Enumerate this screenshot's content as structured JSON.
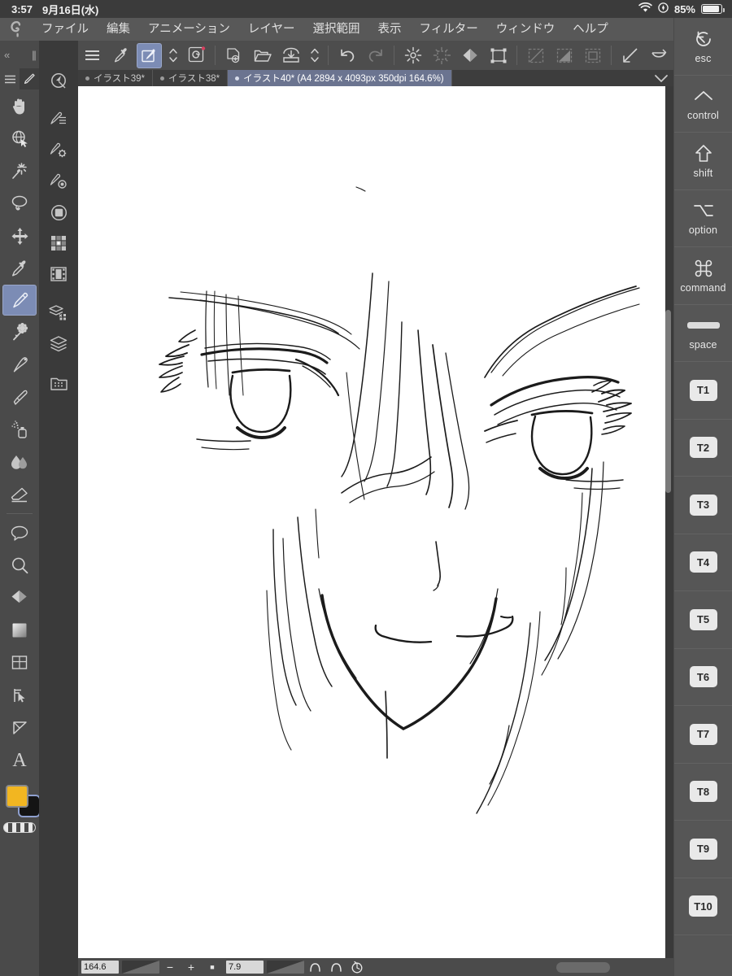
{
  "status_bar": {
    "time": "3:57",
    "date": "9月16日(水)",
    "battery_percent": "85%",
    "wifi_icon": "wifi-icon",
    "location_icon": "location-icon",
    "battery_icon": "battery-icon"
  },
  "menu_bar": {
    "app_logo": "clip-studio-logo",
    "items": [
      {
        "label": "ファイル",
        "name": "menu-file"
      },
      {
        "label": "編集",
        "name": "menu-edit"
      },
      {
        "label": "アニメーション",
        "name": "menu-animation"
      },
      {
        "label": "レイヤー",
        "name": "menu-layer"
      },
      {
        "label": "選択範囲",
        "name": "menu-selection"
      },
      {
        "label": "表示",
        "name": "menu-view"
      },
      {
        "label": "フィルター",
        "name": "menu-filter"
      },
      {
        "label": "ウィンドウ",
        "name": "menu-window"
      },
      {
        "label": "ヘルプ",
        "name": "menu-help"
      }
    ]
  },
  "command_bar": {
    "buttons": [
      {
        "name": "hamburger-menu-icon",
        "selected": false,
        "dim": false
      },
      {
        "name": "eyedropper-icon",
        "selected": false,
        "dim": false
      },
      {
        "name": "brush-swap-icon",
        "selected": true,
        "dim": false
      },
      {
        "name": "chevron-updown-icon",
        "selected": false,
        "dim": false
      },
      {
        "name": "spiral-tool-icon",
        "selected": false,
        "dim": false
      },
      {
        "name": "new-document-icon",
        "selected": false,
        "dim": false
      },
      {
        "name": "open-folder-icon",
        "selected": false,
        "dim": false
      },
      {
        "name": "save-icon",
        "selected": false,
        "dim": false
      },
      {
        "name": "chevron-updown-2-icon",
        "selected": false,
        "dim": false
      },
      {
        "name": "undo-icon",
        "selected": false,
        "dim": false
      },
      {
        "name": "redo-icon",
        "selected": false,
        "dim": true
      },
      {
        "name": "deselect-burst-icon",
        "selected": false,
        "dim": false
      },
      {
        "name": "select-burst-icon",
        "selected": false,
        "dim": true
      },
      {
        "name": "fill-diamond-icon",
        "selected": false,
        "dim": false
      },
      {
        "name": "transform-icon",
        "selected": false,
        "dim": false
      },
      {
        "name": "clear-selection-icon",
        "selected": false,
        "dim": true
      },
      {
        "name": "invert-selection-icon",
        "selected": false,
        "dim": true
      },
      {
        "name": "selection-border-icon",
        "selected": false,
        "dim": true
      },
      {
        "name": "ruler-snap-icon",
        "selected": false,
        "dim": false
      },
      {
        "name": "curve-snap-icon",
        "selected": false,
        "dim": false
      },
      {
        "name": "perspective-snap-icon",
        "selected": true,
        "dim": false
      },
      {
        "name": "chevron-down-icon",
        "selected": false,
        "dim": false
      }
    ]
  },
  "document_tabs": {
    "tabs": [
      {
        "label": "イラスト39*",
        "active": false,
        "name": "document-tab-illust39"
      },
      {
        "label": "イラスト38*",
        "active": false,
        "name": "document-tab-illust38"
      },
      {
        "label": "イラスト40* (A4 2894 x 4093px 350dpi 164.6%)",
        "active": true,
        "name": "document-tab-illust40"
      }
    ],
    "overflow_icon": "chevron-down-icon"
  },
  "left_toolbar": {
    "collapse_icon": "double-chevron-left-icon",
    "grip_icon": "grip-handle-icon",
    "tab_menu_icon": "hamburger-menu-icon",
    "tab_brush_icon": "pencil-icon",
    "tools": [
      {
        "name": "hand-tool",
        "icon": "hand-icon",
        "selected": false
      },
      {
        "name": "rotate-tool",
        "icon": "rotate-cube-icon",
        "selected": false
      },
      {
        "name": "magic-wand-tool",
        "icon": "magic-wand-icon",
        "selected": false
      },
      {
        "name": "lasso-tool",
        "icon": "lasso-icon",
        "selected": false
      },
      {
        "name": "move-tool",
        "icon": "move-arrows-icon",
        "selected": false
      },
      {
        "name": "eyedropper-tool",
        "icon": "eyedropper-icon",
        "selected": false
      },
      {
        "name": "pen-tool",
        "icon": "pen-icon",
        "selected": true
      },
      {
        "name": "decoration-tool",
        "icon": "flower-decoration-icon",
        "selected": false
      },
      {
        "name": "pencil-tool",
        "icon": "pencil-tip-icon",
        "selected": false
      },
      {
        "name": "brush-tool",
        "icon": "paintbrush-icon",
        "selected": false
      },
      {
        "name": "airbrush-tool",
        "icon": "airbrush-spray-icon",
        "selected": false
      },
      {
        "name": "blend-tool",
        "icon": "blend-drops-icon",
        "selected": false
      },
      {
        "name": "eraser-tool",
        "icon": "eraser-icon",
        "selected": false
      },
      {
        "name": "balloon-tool",
        "icon": "speech-balloon-icon",
        "selected": false
      },
      {
        "name": "zoom-tool",
        "icon": "magnifier-icon",
        "selected": false
      },
      {
        "name": "fill-tool",
        "icon": "paint-bucket-icon",
        "selected": false
      },
      {
        "name": "gradient-tool",
        "icon": "gradient-square-icon",
        "selected": false
      },
      {
        "name": "frame-tool",
        "icon": "frame-border-icon",
        "selected": false
      },
      {
        "name": "object-tool",
        "icon": "object-arrow-icon",
        "selected": false
      },
      {
        "name": "figure-tool",
        "icon": "figure-triangle-icon",
        "selected": false
      },
      {
        "name": "text-tool",
        "icon": "text-a-icon",
        "selected": false
      }
    ],
    "colors": {
      "foreground": "#F2B621",
      "background": "#141414",
      "transparent_label": "transparent-color-swatch"
    }
  },
  "palette_rail": {
    "icons": [
      {
        "name": "navigator-icon"
      },
      {
        "name": "subtool-detail-icon"
      },
      {
        "name": "tool-property-icon"
      },
      {
        "name": "brush-settings-icon"
      },
      {
        "name": "color-circle-icon"
      },
      {
        "name": "color-set-grid-icon"
      },
      {
        "name": "animation-timeline-icon"
      },
      {
        "name": "layer-property-icon"
      },
      {
        "name": "layer-stack-icon"
      },
      {
        "name": "material-library-icon"
      }
    ]
  },
  "canvas": {
    "background": "#ffffff",
    "artwork_description": "anime-face-line-sketch",
    "scrollbar": "vertical-scrollbar"
  },
  "footer": {
    "zoom_value": "164.6",
    "rotation_value": "7.9",
    "zoom_out_label": "−",
    "zoom_in_label": "+",
    "reset_zoom_label": "■",
    "rotate_left_icon": "rotate-left-icon",
    "rotate_right_icon": "rotate-right-icon",
    "reset_rotation_icon": "reset-rotation-icon",
    "home_indicator": "home-indicator"
  },
  "key_sidebar": {
    "keys": [
      {
        "label": "esc",
        "glyph": "esc-arrow-icon",
        "type": "modifier",
        "name": "key-esc"
      },
      {
        "label": "control",
        "glyph": "chevron-up-icon",
        "type": "modifier",
        "name": "key-control"
      },
      {
        "label": "shift",
        "glyph": "shift-arrow-icon",
        "type": "modifier",
        "name": "key-shift"
      },
      {
        "label": "option",
        "glyph": "option-icon",
        "type": "modifier",
        "name": "key-option"
      },
      {
        "label": "command",
        "glyph": "command-icon",
        "type": "modifier",
        "name": "key-command"
      },
      {
        "label": "space",
        "glyph": "spacebar-icon",
        "type": "modifier",
        "name": "key-space"
      },
      {
        "label": "T1",
        "type": "tkey",
        "name": "key-t1"
      },
      {
        "label": "T2",
        "type": "tkey",
        "name": "key-t2"
      },
      {
        "label": "T3",
        "type": "tkey",
        "name": "key-t3"
      },
      {
        "label": "T4",
        "type": "tkey",
        "name": "key-t4"
      },
      {
        "label": "T5",
        "type": "tkey",
        "name": "key-t5"
      },
      {
        "label": "T6",
        "type": "tkey",
        "name": "key-t6"
      },
      {
        "label": "T7",
        "type": "tkey",
        "name": "key-t7"
      },
      {
        "label": "T8",
        "type": "tkey",
        "name": "key-t8"
      },
      {
        "label": "T9",
        "type": "tkey",
        "name": "key-t9"
      },
      {
        "label": "T10",
        "type": "tkey",
        "name": "key-t10"
      }
    ]
  }
}
